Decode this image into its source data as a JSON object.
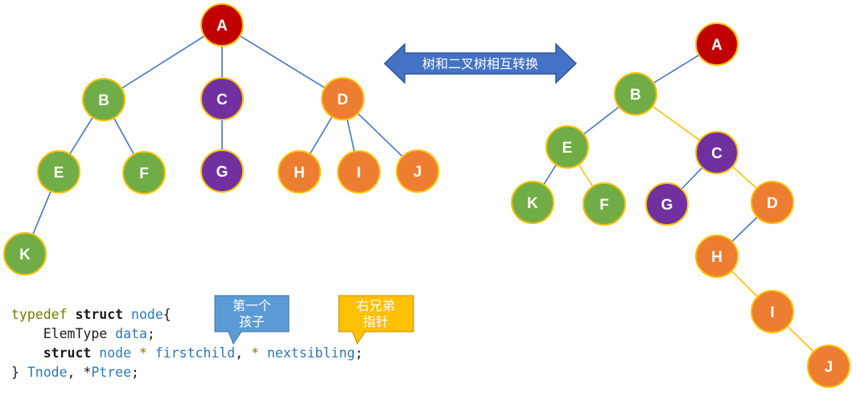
{
  "colors": {
    "red": "#c00000",
    "green": "#70ad47",
    "purple": "#7030a0",
    "orange": "#ed7d31",
    "border": "#ffc000",
    "edge_blue": "#4472c4",
    "edge_yellow": "#ffc000",
    "arrow_fill": "#4472c4",
    "bubble_blue": "#5b9bd5",
    "bubble_yellow": "#ffc000"
  },
  "arrow": {
    "label": "树和二叉树相互转换"
  },
  "bubbles": {
    "first_child": {
      "line1": "第一个",
      "line2": "孩子"
    },
    "next_sibling": {
      "line1": "右兄弟",
      "line2": "指针"
    }
  },
  "tree": {
    "nodes": [
      {
        "id": "A",
        "color": "red"
      },
      {
        "id": "B",
        "color": "green"
      },
      {
        "id": "C",
        "color": "purple"
      },
      {
        "id": "D",
        "color": "orange"
      },
      {
        "id": "E",
        "color": "green"
      },
      {
        "id": "F",
        "color": "green"
      },
      {
        "id": "G",
        "color": "purple"
      },
      {
        "id": "H",
        "color": "orange"
      },
      {
        "id": "I",
        "color": "orange"
      },
      {
        "id": "J",
        "color": "orange"
      },
      {
        "id": "K",
        "color": "green"
      }
    ],
    "edges": [
      [
        "A",
        "B"
      ],
      [
        "A",
        "C"
      ],
      [
        "A",
        "D"
      ],
      [
        "B",
        "E"
      ],
      [
        "B",
        "F"
      ],
      [
        "C",
        "G"
      ],
      [
        "D",
        "H"
      ],
      [
        "D",
        "I"
      ],
      [
        "D",
        "J"
      ],
      [
        "E",
        "K"
      ]
    ]
  },
  "binary_tree": {
    "nodes": [
      {
        "id": "A",
        "color": "red"
      },
      {
        "id": "B",
        "color": "green"
      },
      {
        "id": "E",
        "color": "green"
      },
      {
        "id": "C",
        "color": "purple"
      },
      {
        "id": "K",
        "color": "green"
      },
      {
        "id": "F",
        "color": "green"
      },
      {
        "id": "G",
        "color": "purple"
      },
      {
        "id": "D",
        "color": "orange"
      },
      {
        "id": "H",
        "color": "orange"
      },
      {
        "id": "I",
        "color": "orange"
      },
      {
        "id": "J",
        "color": "orange"
      }
    ],
    "edges": [
      {
        "from": "A",
        "to": "B",
        "kind": "child"
      },
      {
        "from": "B",
        "to": "E",
        "kind": "child"
      },
      {
        "from": "B",
        "to": "C",
        "kind": "sibling"
      },
      {
        "from": "E",
        "to": "K",
        "kind": "child"
      },
      {
        "from": "E",
        "to": "F",
        "kind": "sibling"
      },
      {
        "from": "C",
        "to": "G",
        "kind": "child"
      },
      {
        "from": "C",
        "to": "D",
        "kind": "sibling"
      },
      {
        "from": "D",
        "to": "H",
        "kind": "child"
      },
      {
        "from": "H",
        "to": "I",
        "kind": "sibling"
      },
      {
        "from": "I",
        "to": "J",
        "kind": "sibling"
      }
    ]
  },
  "code": {
    "l1_kw": "typedef",
    "l1_struct": "struct",
    "l1_name": "node",
    "l1_brace": "{",
    "l2_type": "ElemType",
    "l2_field": "data",
    "l2_end": ";",
    "l3_struct": "struct",
    "l3_name": "node",
    "l3_star1": "*",
    "l3_field1": "firstchild",
    "l3_comma": ",",
    "l3_star2": "*",
    "l3_field2": "nextsibling",
    "l3_end": ";",
    "l4_brace": "}",
    "l4_type": "Tnode",
    "l4_comma": ",",
    "l4_star": "*",
    "l4_ptr": "Ptree",
    "l4_end": ";"
  }
}
